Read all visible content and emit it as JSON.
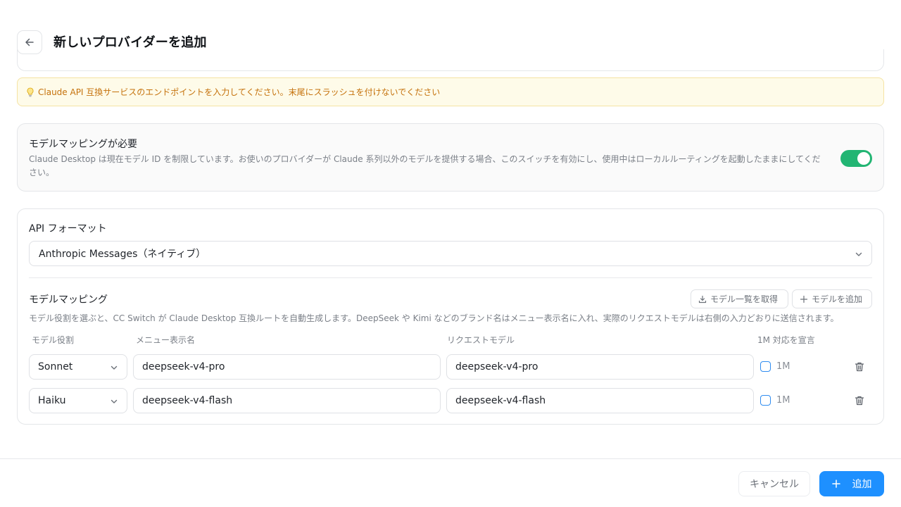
{
  "header": {
    "title": "新しいプロバイダーを追加",
    "back_icon": "arrow-left-icon"
  },
  "hint": {
    "icon": "lightbulb-icon",
    "text": "Claude API 互換サービスのエンドポイントを入力してください。末尾にスラッシュを付けないでください",
    "color": "#c5720c"
  },
  "model_mapping_toggle": {
    "title": "モデルマッピングが必要",
    "description": "Claude Desktop は現在モデル ID を制限しています。お使いのプロバイダーが Claude 系列以外のモデルを提供する場合、このスイッチを有効にし、使用中はローカルルーティングを起動したままにしてください。",
    "enabled": true,
    "toggle_color": "#22b573"
  },
  "api_format": {
    "label": "API フォーマット",
    "selected": "Anthropic Messages（ネイティブ）"
  },
  "model_mapping": {
    "title": "モデルマッピング",
    "fetch_button": "モデル一覧を取得",
    "add_button": "モデルを追加",
    "description": "モデル役割を選ぶと、CC Switch が Claude Desktop 互換ルートを自動生成します。DeepSeek や Kimi などのブランド名はメニュー表示名に入れ、実際のリクエストモデルは右側の入力どおりに送信されます。",
    "columns": {
      "role": "モデル役割",
      "display_name": "メニュー表示名",
      "request_model": "リクエストモデル",
      "declare_1m": "1M 対応を宣言"
    },
    "rows": [
      {
        "role": "Sonnet",
        "display_name": "deepseek-v4-pro",
        "request_model": "deepseek-v4-pro",
        "one_m_label": "1M",
        "one_m_checked": false
      },
      {
        "role": "Haiku",
        "display_name": "deepseek-v4-flash",
        "request_model": "deepseek-v4-flash",
        "one_m_label": "1M",
        "one_m_checked": false
      }
    ]
  },
  "footer": {
    "cancel": "キャンセル",
    "submit": "追加",
    "accent": "#1e90ff"
  }
}
